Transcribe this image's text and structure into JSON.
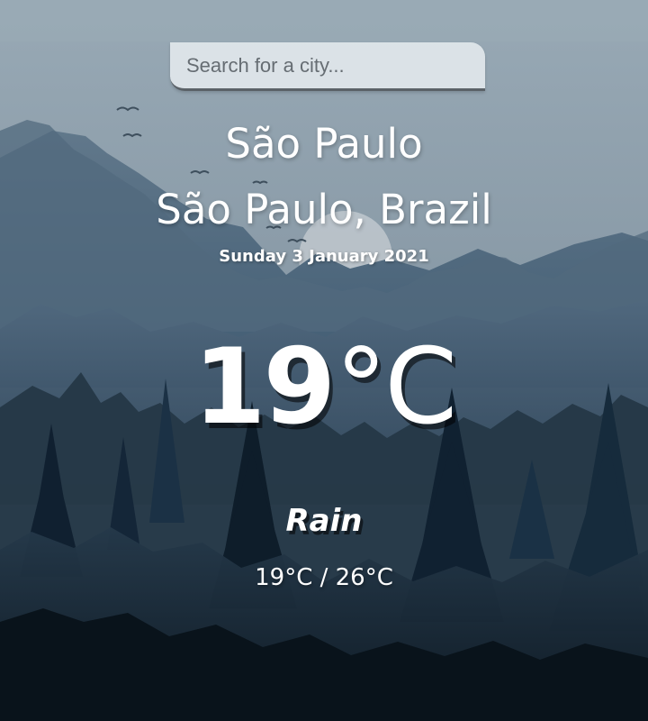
{
  "search": {
    "placeholder": "Search for a city..."
  },
  "weather": {
    "city": "São Paulo",
    "location": "São Paulo, Brazil",
    "date": "Sunday 3 January 2021",
    "temperature": "19",
    "temperature_unit": "°C",
    "condition": "Rain",
    "range": "19°C / 26°C"
  }
}
